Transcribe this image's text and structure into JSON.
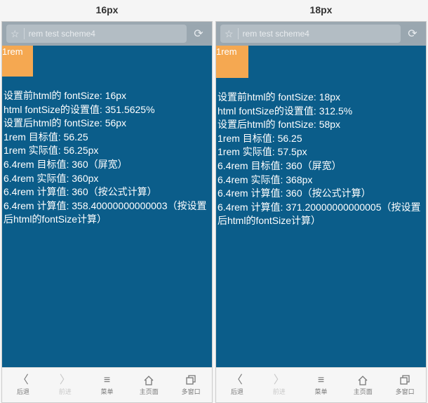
{
  "columns": [
    {
      "header": "16px",
      "browser": {
        "url": "rem test scheme4"
      },
      "rem_box_label": "1rem",
      "lines": [
        "设置前html的 fontSize: 16px",
        "html fontSize的设置值: 351.5625%",
        "设置后html的 fontSize: 56px",
        "1rem 目标值: 56.25",
        "1rem 实际值: 56.25px",
        "6.4rem 目标值: 360（屏宽）",
        "6.4rem 实际值: 360px",
        "6.4rem 计算值: 360（按公式计算）",
        "6.4rem 计算值: 358.40000000000003（按设置后html的fontSize计算）"
      ],
      "nav": {
        "back": "后退",
        "forward": "前进",
        "menu": "菜单",
        "home": "主页面",
        "windows": "多窗口"
      }
    },
    {
      "header": "18px",
      "browser": {
        "url": "rem test scheme4"
      },
      "rem_box_label": "1rem",
      "lines": [
        "设置前html的 fontSize: 18px",
        "html fontSize的设置值: 312.5%",
        "设置后html的 fontSize: 58px",
        "1rem 目标值: 56.25",
        "1rem 实际值: 57.5px",
        "6.4rem 目标值: 360（屏宽）",
        "6.4rem 实际值: 368px",
        "6.4rem 计算值: 360（按公式计算）",
        "6.4rem 计算值: 371.20000000000005（按设置后html的fontSize计算）"
      ],
      "nav": {
        "back": "后退",
        "forward": "前进",
        "menu": "菜单",
        "home": "主页面",
        "windows": "多窗口"
      }
    }
  ]
}
